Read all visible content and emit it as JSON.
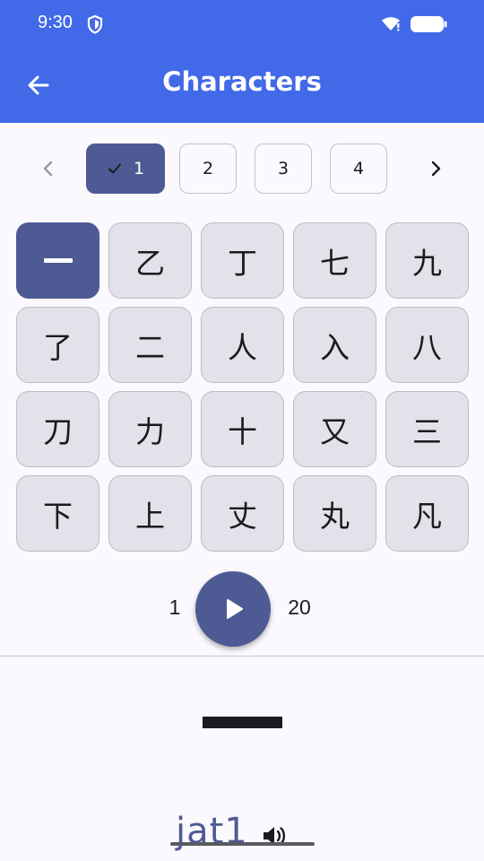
{
  "status_bar": {
    "time": "9:30"
  },
  "app_bar": {
    "title": "Characters"
  },
  "pager": {
    "pages": [
      {
        "label": "1",
        "selected": true
      },
      {
        "label": "2",
        "selected": false
      },
      {
        "label": "3",
        "selected": false
      },
      {
        "label": "4",
        "selected": false
      }
    ]
  },
  "grid": {
    "cells": [
      "乙",
      "丁",
      "七",
      "九",
      "了",
      "二",
      "人",
      "入",
      "八",
      "刀",
      "力",
      "十",
      "又",
      "三",
      "下",
      "上",
      "丈",
      "丸",
      "凡"
    ]
  },
  "playback": {
    "range_start": "1",
    "range_end": "20"
  },
  "display": {
    "jyutping": "jat1"
  },
  "colors": {
    "app_bar": "#4169e8",
    "accent": "#4e5a93",
    "cell_bg": "#e3e1ea",
    "background": "#fbf8fe"
  }
}
